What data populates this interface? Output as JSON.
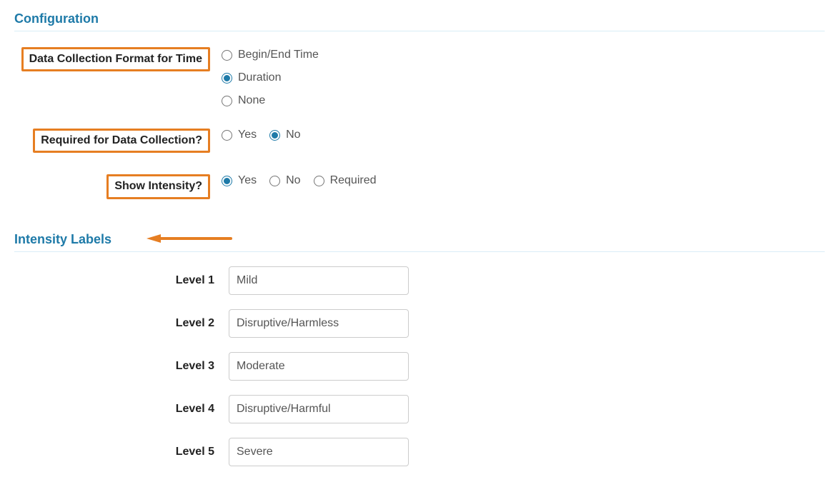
{
  "configuration": {
    "title": "Configuration",
    "format": {
      "label": "Data Collection Format for Time",
      "options": {
        "begin_end": "Begin/End Time",
        "duration": "Duration",
        "none": "None"
      },
      "selected": "duration"
    },
    "required": {
      "label": "Required for Data Collection?",
      "options": {
        "yes": "Yes",
        "no": "No"
      },
      "selected": "no"
    },
    "show_intensity": {
      "label": "Show Intensity?",
      "options": {
        "yes": "Yes",
        "no": "No",
        "required": "Required"
      },
      "selected": "yes"
    }
  },
  "intensity": {
    "title": "Intensity Labels",
    "levels": [
      {
        "label": "Level 1",
        "value": "Mild"
      },
      {
        "label": "Level 2",
        "value": "Disruptive/Harmless"
      },
      {
        "label": "Level 3",
        "value": "Moderate"
      },
      {
        "label": "Level 4",
        "value": "Disruptive/Harmful"
      },
      {
        "label": "Level 5",
        "value": "Severe"
      }
    ]
  },
  "annotations": {
    "arrow_color": "#e67e22"
  }
}
